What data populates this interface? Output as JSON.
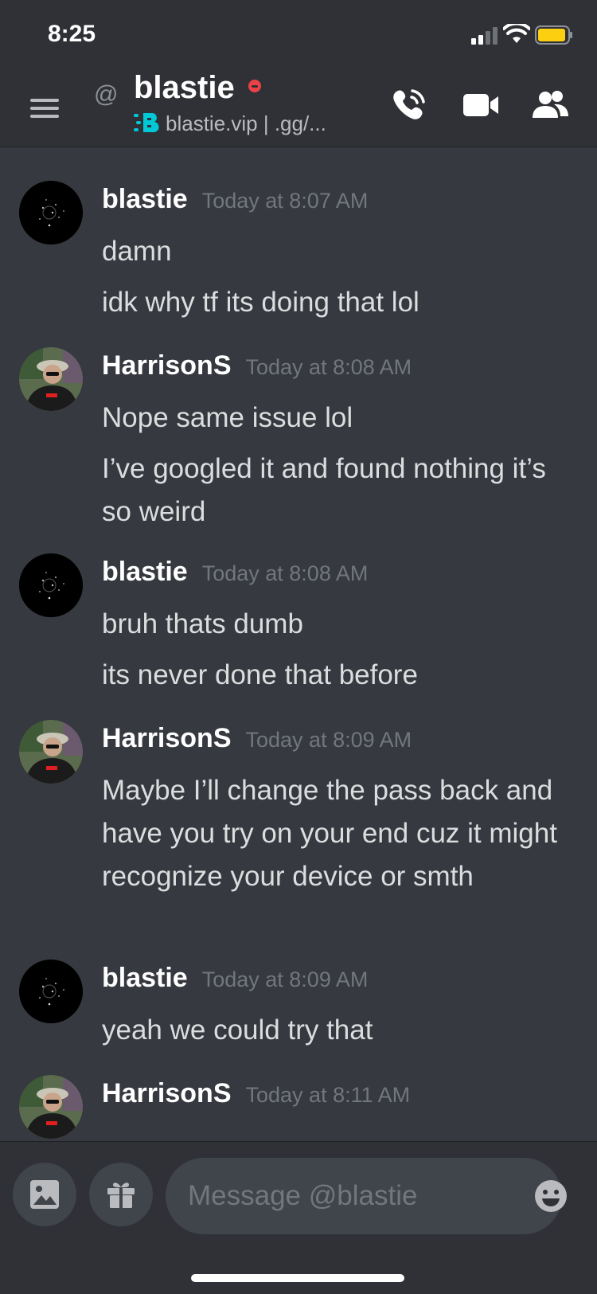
{
  "status_bar": {
    "time": "8:25"
  },
  "header": {
    "at_symbol": "@",
    "username": "blastie",
    "custom_status": "blastie.vip | .gg/...",
    "colors": {
      "dnd": "#ed4245",
      "status_icon": "#00c8d7"
    }
  },
  "messages": [
    {
      "author": "blastie",
      "avatar": "blastie",
      "time": "Today at 8:07 AM",
      "lines": [
        "damn",
        "idk why tf its doing that lol"
      ]
    },
    {
      "author": "HarrisonS",
      "avatar": "harrison",
      "time": "Today at 8:08 AM",
      "lines": [
        "Nope same issue lol",
        "I’ve googled it and found nothing it’s so weird"
      ]
    },
    {
      "author": "blastie",
      "avatar": "blastie",
      "time": "Today at 8:08 AM",
      "lines": [
        "bruh thats dumb",
        "its never done that before"
      ]
    },
    {
      "author": "HarrisonS",
      "avatar": "harrison",
      "time": "Today at 8:09 AM",
      "lines": [
        "Maybe I’ll change the pass back and have you try on your end cuz it might recognize your device or smth"
      ]
    },
    {
      "author": "blastie",
      "avatar": "blastie",
      "time": "Today at 8:09 AM",
      "lines": [
        "yeah we could try that"
      ]
    },
    {
      "author": "HarrisonS",
      "avatar": "harrison",
      "time": "Today at 8:11 AM",
      "lines": []
    }
  ],
  "composer": {
    "placeholder": "Message @blastie"
  },
  "icons": [
    "signal-icon",
    "wifi-icon",
    "battery-icon",
    "hamburger-icon",
    "at-icon",
    "call-icon",
    "video-icon",
    "members-icon",
    "image-icon",
    "gift-icon",
    "emoji-icon"
  ]
}
